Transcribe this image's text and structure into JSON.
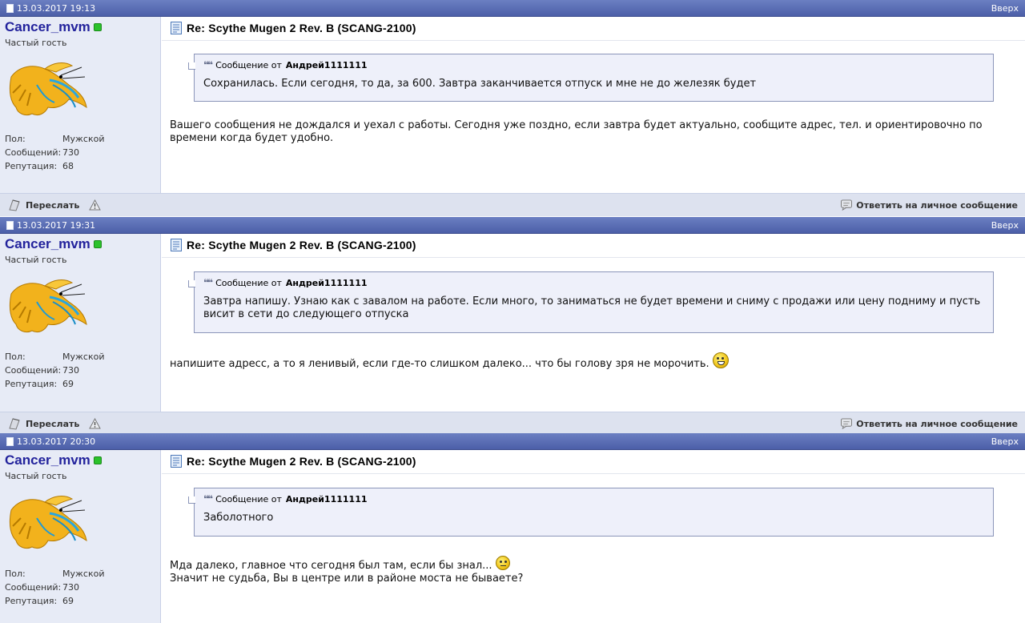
{
  "posts": [
    {
      "date": "13.03.2017 19:13",
      "top_link": "Вверх",
      "username": "Cancer_mvm",
      "rank": "Частый гость",
      "stats": [
        {
          "label": "Пол:",
          "value": "Мужской"
        },
        {
          "label": "Сообщений:",
          "value": "730"
        },
        {
          "label": "Репутация:",
          "value": "68"
        }
      ],
      "title": "Re: Scythe Mugen 2 Rev. B (SCANG-2100)",
      "quote_prefix": "Сообщение от",
      "quote_author": "Андрей1111111",
      "quote_text": "Сохранилась. Если сегодня, то да, за 600. Завтра заканчивается отпуск и мне не до железяк будет",
      "text_lines": [
        "Вашего сообщения не дождался и уехал с работы. Сегодня уже поздно, если завтра будет актуально, сообщите адрес, тел. и ориентировочно по времени когда будет удобно."
      ],
      "forward_label": "Переслать",
      "reply_label": "Ответить на личное сообщение"
    },
    {
      "date": "13.03.2017 19:31",
      "top_link": "Вверх",
      "username": "Cancer_mvm",
      "rank": "Частый гость",
      "stats": [
        {
          "label": "Пол:",
          "value": "Мужской"
        },
        {
          "label": "Сообщений:",
          "value": "730"
        },
        {
          "label": "Репутация:",
          "value": "69"
        }
      ],
      "title": "Re: Scythe Mugen 2 Rev. B (SCANG-2100)",
      "quote_prefix": "Сообщение от",
      "quote_author": "Андрей1111111",
      "quote_text": "Завтра напишу. Узнаю как с завалом на работе. Если много, то заниматься не будет времени и сниму с продажи или цену подниму и пусть висит в сети до следующего отпуска",
      "text_lines": [
        "напишите адресс, а то я ленивый, если где-то слишком далеко... что бы голову зря не морочить."
      ],
      "forward_label": "Переслать",
      "reply_label": "Ответить на личное сообщение"
    },
    {
      "date": "13.03.2017 20:30",
      "top_link": "Вверх",
      "username": "Cancer_mvm",
      "rank": "Частый гость",
      "stats": [
        {
          "label": "Пол:",
          "value": "Мужской"
        },
        {
          "label": "Сообщений:",
          "value": "730"
        },
        {
          "label": "Репутация:",
          "value": "69"
        }
      ],
      "title": "Re: Scythe Mugen 2 Rev. B (SCANG-2100)",
      "quote_prefix": "Сообщение от",
      "quote_author": "Андрей1111111",
      "quote_text": "Заболотного",
      "text_lines": [
        "Мда далеко, главное что сегодня был там, если бы знал...",
        "Значит не судьба, Вы в центре или в районе моста не бываете?"
      ],
      "forward_label": "Переслать",
      "reply_label": "Ответить на личное сообщение"
    }
  ],
  "icons": {
    "online": "online-status-icon",
    "avatar": "crayfish-avatar",
    "doc": "document-icon",
    "quote": "quote-icon",
    "forward": "forward-icon",
    "report": "warning-icon",
    "reply": "reply-icon",
    "smiley_grin": "grin-smiley-icon",
    "smiley_neutral": "neutral-smiley-icon"
  },
  "colors": {
    "header_bar": "#5a6db6",
    "user_panel": "#e7ebf6",
    "username": "#22229c",
    "online": "#2bc22b",
    "quote_bg": "#eef0fa",
    "footer_bar": "#dde2ef"
  }
}
